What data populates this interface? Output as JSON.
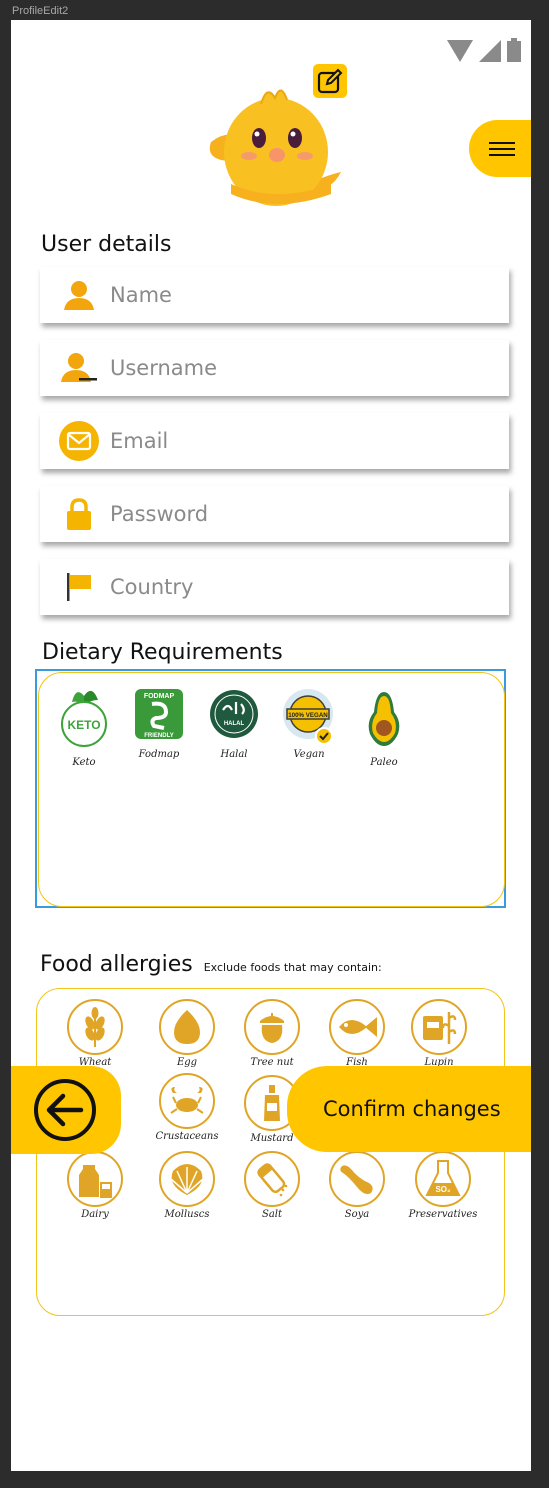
{
  "frame_label": "ProfileEdit2",
  "user_details": {
    "title": "User details",
    "fields": {
      "name": "Name",
      "username": "Username",
      "email": "Email",
      "password": "Password",
      "country": "Country"
    }
  },
  "dietary": {
    "title": "Dietary Requirements",
    "items": [
      "Keto",
      "Fodmap",
      "Halal",
      "Vegan",
      "Paleo"
    ],
    "badge_keto": "KETO",
    "badge_fodmap_top": "FODMAP",
    "badge_fodmap_bottom": "FRIENDLY",
    "badge_halal": "HALAL",
    "badge_vegan": "100% VEGAN"
  },
  "allergies": {
    "title": "Food allergies",
    "subtitle": "Exclude foods that may contain:",
    "items": [
      "Wheat",
      "Egg",
      "Tree nut",
      "Fish",
      "Lupin",
      "Crustaceans",
      "Mustard",
      "Dairy",
      "Molluscs",
      "Salt",
      "Soya",
      "Preservatives"
    ]
  },
  "confirm_label": "Confirm changes",
  "colors": {
    "accent": "#ffc600",
    "allergy_icon": "#e0a526",
    "selection": "#3a9bdc"
  }
}
